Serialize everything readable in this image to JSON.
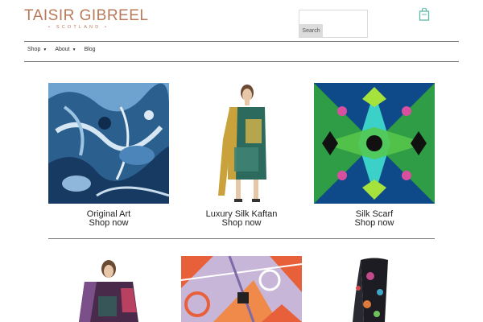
{
  "logo": {
    "name": "TAISIR GIBREEL",
    "tagline": "• SCOTLAND •"
  },
  "search": {
    "button_label": "Search",
    "placeholder": ""
  },
  "nav": {
    "items": [
      {
        "label": "Shop",
        "has_dropdown": true
      },
      {
        "label": "About",
        "has_dropdown": true
      },
      {
        "label": "Blog",
        "has_dropdown": false
      }
    ],
    "caret": "▼"
  },
  "products": [
    {
      "title": "Original Art",
      "link": "Shop now",
      "image": "blue-abstract-painting"
    },
    {
      "title": "Luxury Silk Kaftan",
      "link": "Shop now",
      "image": "model-in-green-kaftan"
    },
    {
      "title": "Silk Scarf",
      "link": "Shop now",
      "image": "green-kaleidoscope-pattern"
    }
  ],
  "second_row": [
    {
      "image": "model-in-purple-kaftan"
    },
    {
      "image": "orange-lilac-geometric-print"
    },
    {
      "image": "dark-floral-scarf"
    }
  ],
  "colors": {
    "brand": "#b87a5a",
    "cart": "#5fb8a8",
    "rule": "#7a7a7a"
  },
  "icons": {
    "cart": "shopping-bag-icon"
  }
}
